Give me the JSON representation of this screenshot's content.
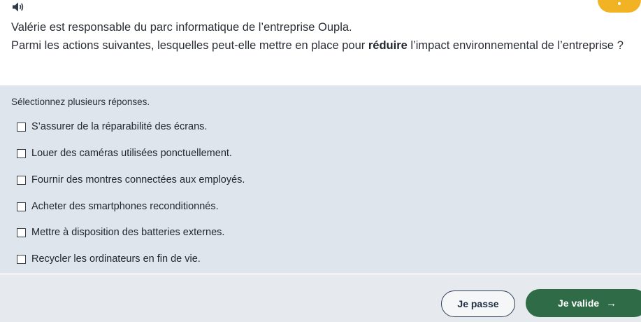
{
  "question": {
    "intro": "Valérie est responsable du parc informatique de l’entreprise Oupla.",
    "prompt_before": "Parmi les actions suivantes, lesquelles peut-elle mettre en place pour ",
    "prompt_bold": "réduire",
    "prompt_after": " l’impact environnemental de l’entreprise ?"
  },
  "answers": {
    "instruction": "Sélectionnez plusieurs réponses.",
    "options": [
      {
        "label": "S’assurer de la réparabilité des écrans.",
        "checked": false
      },
      {
        "label": "Louer des caméras utilisées ponctuellement.",
        "checked": false
      },
      {
        "label": "Fournir des montres connectées aux employés.",
        "checked": false
      },
      {
        "label": "Acheter des smartphones reconditionnés.",
        "checked": false
      },
      {
        "label": "Mettre à disposition des batteries externes.",
        "checked": false
      },
      {
        "label": "Recycler les ordinateurs en fin de vie.",
        "checked": false
      }
    ]
  },
  "footer": {
    "skip_label": "Je passe",
    "validate_label": "Je valide",
    "validate_icon": "arrow-right-icon"
  },
  "colors": {
    "accent": "#f1b323",
    "validate_bg": "#2f6b46",
    "skip_border": "#2f3f57",
    "answers_bg": "#dfe5ec"
  }
}
